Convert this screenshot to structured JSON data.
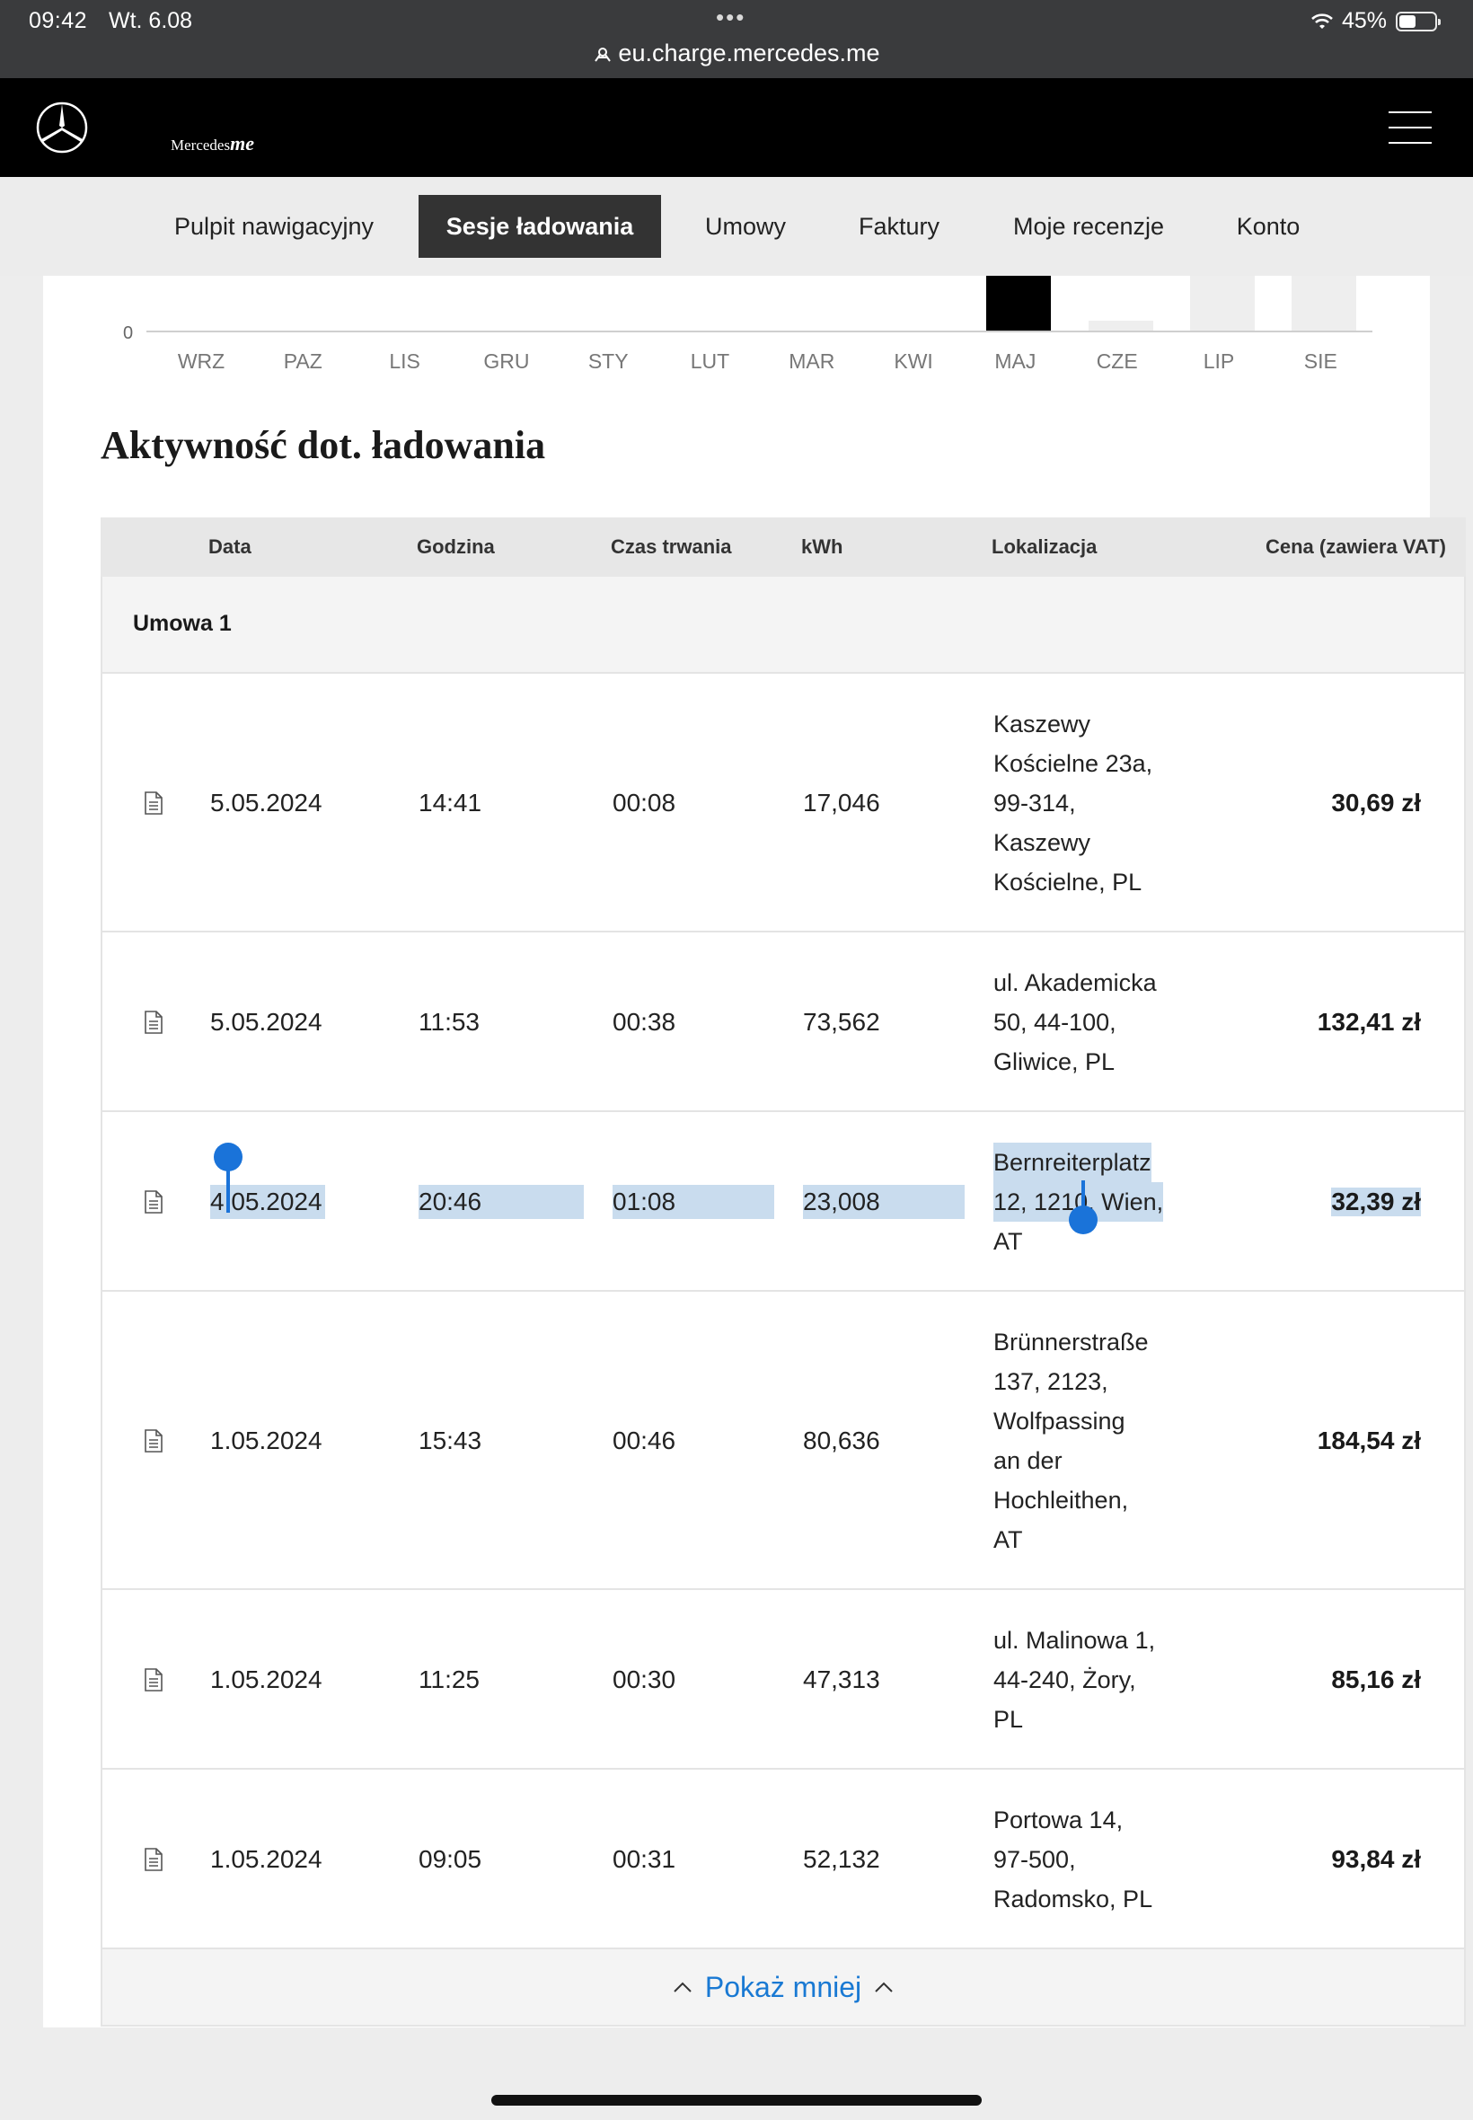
{
  "status": {
    "time": "09:42",
    "date": "Wt. 6.08",
    "battery": "45%",
    "dots": "•••",
    "url": "eu.charge.mercedes.me"
  },
  "brand": {
    "name": "Mercedes",
    "suffix": "me"
  },
  "nav": {
    "tabs": [
      {
        "label": "Pulpit nawigacyjny",
        "active": false
      },
      {
        "label": "Sesje ładowania",
        "active": true
      },
      {
        "label": "Umowy",
        "active": false
      },
      {
        "label": "Faktury",
        "active": false
      },
      {
        "label": "Moje recenzje",
        "active": false
      },
      {
        "label": "Konto",
        "active": false
      }
    ]
  },
  "chart_data": {
    "type": "bar",
    "categories": [
      "WRZ",
      "PAZ",
      "LIS",
      "GRU",
      "STY",
      "LUT",
      "MAR",
      "KWI",
      "MAJ",
      "CZE",
      "LIP",
      "SIE"
    ],
    "y_zero_label": "0",
    "highlighted": "MAJ",
    "colors": {
      "highlight": "#000000",
      "other": "#eeeeee"
    }
  },
  "activity": {
    "title": "Aktywność dot. ładowania",
    "columns": {
      "date": "Data",
      "time": "Godzina",
      "duration": "Czas trwania",
      "kwh": "kWh",
      "location": "Lokalizacja",
      "price": "Cena (zawiera VAT)"
    },
    "group_label": "Umowa 1",
    "rows": [
      {
        "date": "5.05.2024",
        "time": "14:41",
        "duration": "00:08",
        "kwh": "17,046",
        "location": [
          "Kaszewy",
          "Kościelne 23a,",
          "99-314,",
          "Kaszewy",
          "Kościelne, PL"
        ],
        "price": "30,69 zł"
      },
      {
        "date": "5.05.2024",
        "time": "11:53",
        "duration": "00:38",
        "kwh": "73,562",
        "location": [
          "ul. Akademicka",
          "50, 44-100,",
          "Gliwice, PL"
        ],
        "price": "132,41 zł"
      },
      {
        "date": "4.05.2024",
        "time": "20:46",
        "duration": "01:08",
        "kwh": "23,008",
        "location": [
          "Bernreiterplatz",
          "12, 1210, Wien,",
          "AT"
        ],
        "price": "32,39 zł"
      },
      {
        "date": "1.05.2024",
        "time": "15:43",
        "duration": "00:46",
        "kwh": "80,636",
        "location": [
          "Brünnerstraße",
          "137, 2123,",
          "Wolfpassing",
          "an der",
          "Hochleithen,",
          "AT"
        ],
        "price": "184,54 zł"
      },
      {
        "date": "1.05.2024",
        "time": "11:25",
        "duration": "00:30",
        "kwh": "47,313",
        "location": [
          "ul. Malinowa 1,",
          "44-240, Żory,",
          "PL"
        ],
        "price": "85,16 zł"
      },
      {
        "date": "1.05.2024",
        "time": "09:05",
        "duration": "00:31",
        "kwh": "52,132",
        "location": [
          "Portowa 14,",
          "97-500,",
          "Radomsko, PL"
        ],
        "price": "93,84 zł"
      }
    ],
    "show_less": "Pokaż mniej"
  },
  "accent": "#1979d3"
}
